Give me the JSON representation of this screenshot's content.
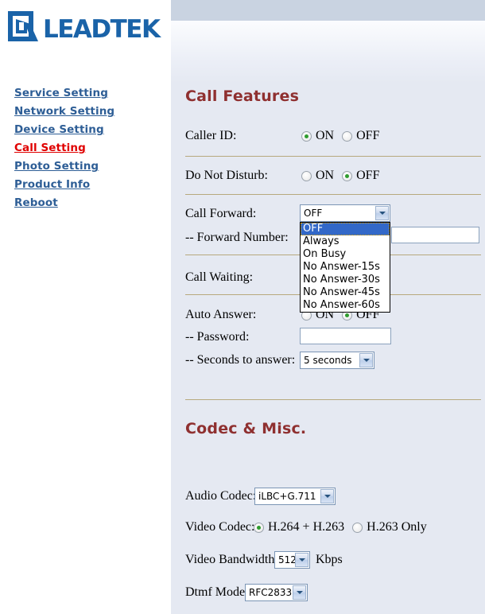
{
  "brand": {
    "logo_text": "LEADTEK",
    "logo_color": "#1a63a8"
  },
  "sidebar": {
    "items": [
      {
        "label": "Service Setting",
        "active": false
      },
      {
        "label": "Network Setting",
        "active": false
      },
      {
        "label": "Device Setting",
        "active": false
      },
      {
        "label": "Call Setting",
        "active": true
      },
      {
        "label": "Photo Setting",
        "active": false
      },
      {
        "label": "Product Info",
        "active": false
      },
      {
        "label": "Reboot",
        "active": false
      }
    ],
    "link_color": "#2e5e96",
    "active_color": "#e00000"
  },
  "main": {
    "sections": {
      "call_features": {
        "title": "Call Features",
        "caller_id": {
          "label": "Caller ID:",
          "on_label": "ON",
          "off_label": "OFF",
          "value": "ON"
        },
        "do_not_disturb": {
          "label": "Do Not Disturb:",
          "on_label": "ON",
          "off_label": "OFF",
          "value": "OFF"
        },
        "call_forward": {
          "label": "Call Forward:",
          "value": "OFF",
          "expanded": true,
          "options": [
            "OFF",
            "Always",
            "On Busy",
            "No Answer-15s",
            "No Answer-30s",
            "No Answer-45s",
            "No Answer-60s"
          ]
        },
        "forward_number": {
          "label": "-- Forward Number:",
          "value": "",
          "placeholder": ""
        },
        "call_waiting": {
          "label": "Call Waiting:"
        },
        "auto_answer": {
          "label": "Auto Answer:",
          "on_label": "ON",
          "off_label": "OFF",
          "value": "OFF"
        },
        "password": {
          "label": "-- Password:",
          "value": "",
          "placeholder": ""
        },
        "seconds_to_answer": {
          "label": "-- Seconds to answer:",
          "value": "5 seconds"
        }
      },
      "codec_misc": {
        "title": "Codec & Misc.",
        "audio_codec": {
          "label": "Audio Codec:",
          "value": "iLBC+G.711"
        },
        "video_codec": {
          "label": "Video Codec:",
          "option_a": "H.264 + H.263",
          "option_b": "H.263 Only",
          "value": "H.264 + H.263"
        },
        "video_bandwidth": {
          "label": "Video Bandwidth:",
          "value": "512",
          "unit": "Kbps"
        },
        "dtmf_mode": {
          "label": "Dtmf Mode:",
          "value": "RFC2833"
        }
      }
    },
    "section_title_color": "#8f3030",
    "divider_color": "#b7a97e"
  }
}
